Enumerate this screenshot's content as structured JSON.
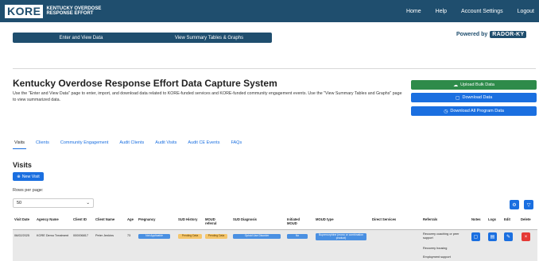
{
  "navbar": {
    "logo_main": "KORE",
    "logo_sub": "KENTUCKY OVERDOSE RESPONSE EFFORT",
    "links": [
      "Home",
      "Help",
      "Account Settings",
      "Logout"
    ]
  },
  "top_buttons": {
    "enter_view": "Enter and View Data",
    "summary": "View Summary Tables & Graphs"
  },
  "powered": {
    "label": "Powered by",
    "brand": "RADOR-KY"
  },
  "header": {
    "title": "Kentucky Overdose Response Effort Data Capture System",
    "description": "Use the \"Enter and View Data\" page to enter, import, and download data related to KORE-funded services and KORE-funded community engagement events. Use the \"View Summary Tables and Graphs\" page to view summarized data."
  },
  "side_buttons": {
    "upload": "Upload Bulk Data",
    "download": "Download Data",
    "download_all": "Download All Program Data"
  },
  "tabs": [
    "Visits",
    "Clients",
    "Community Engagement",
    "Audit Clients",
    "Audit Visits",
    "Audit CE Events",
    "FAQs"
  ],
  "visits": {
    "title": "Visits",
    "new_visit": "New Visit",
    "rows_label": "Rows per page:",
    "rows_value": "50"
  },
  "table": {
    "headers": [
      "Visit Date",
      "Agency Name",
      "Client ID",
      "Client Name",
      "Age",
      "Pregnancy",
      "SUD History",
      "MOUD referral",
      "SUD Diagnosis",
      "Initiated MOUD",
      "MOUD type",
      "Direct Services",
      "Referrals",
      "Notes",
      "Logs",
      "Edit",
      "Delete"
    ],
    "row": {
      "visit_date": "06/02/2025",
      "agency": "KORE Demo Treatment",
      "client_id": "000006817",
      "client_name": "Peter Jenkins",
      "age": "73",
      "pregnancy": "Not Applicable",
      "sud_history": "Pending Data",
      "moud_referral": "Pending Data",
      "sud_diagnosis": "Opioid Use Disorder",
      "initiated_moud": "No",
      "moud_type": "Buprenorphine (mono or combination product)",
      "referrals": [
        "Recovery coaching or peer support",
        "Recovery housing",
        "Employment support"
      ]
    }
  },
  "colors": {
    "navbar": "#1f4e6e",
    "green": "#2e8b4a",
    "blue": "#1a6fe0",
    "delete": "#e53935"
  }
}
